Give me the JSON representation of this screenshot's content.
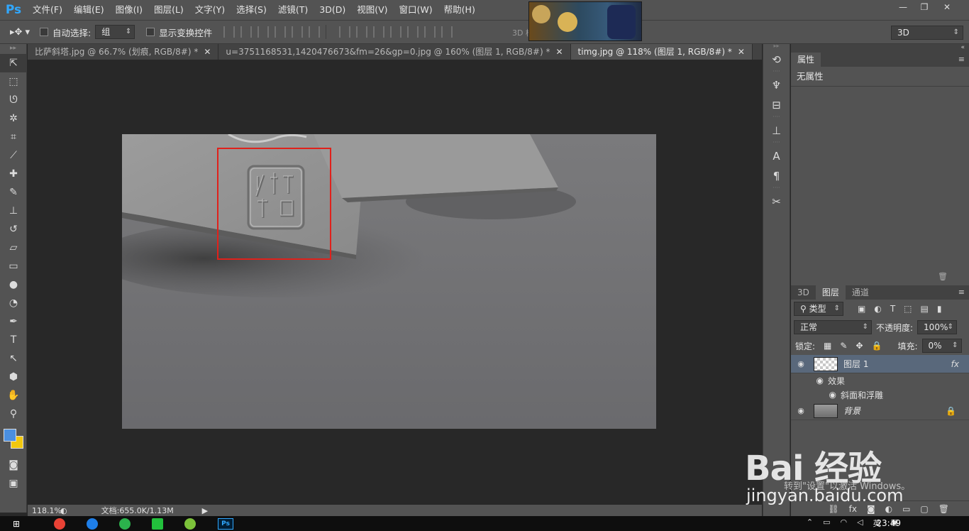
{
  "app": {
    "logo": "Ps"
  },
  "menu": [
    "文件(F)",
    "编辑(E)",
    "图像(I)",
    "图层(L)",
    "文字(Y)",
    "选择(S)",
    "滤镜(T)",
    "3D(D)",
    "视图(V)",
    "窗口(W)",
    "帮助(H)"
  ],
  "window_controls": [
    "—",
    "❐",
    "✕"
  ],
  "options_bar": {
    "auto_select_label": "自动选择:",
    "auto_select_value": "组",
    "show_transform_label": "显示变换控件",
    "mode_label": "3D 模式:",
    "workspace_value": "3D"
  },
  "tabs": [
    {
      "label": "比萨斜塔.jpg @ 66.7% (划痕, RGB/8#) *"
    },
    {
      "label": "u=3751168531,1420476673&fm=26&gp=0.jpg @ 160% (图层 1, RGB/8#) *"
    },
    {
      "label": "timg.jpg @ 118% (图层 1, RGB/8#) *"
    }
  ],
  "tab_close": "✕",
  "status": {
    "zoom": "118.1%",
    "doc_info": "文档:655.0K/1.13M"
  },
  "properties": {
    "tab_label": "属性",
    "empty_label": "无属性"
  },
  "layers_panel": {
    "tabs": [
      "3D",
      "图层",
      "通道"
    ],
    "active_tab": "图层",
    "filter_label": "类型",
    "blend_mode": "正常",
    "opacity_label": "不透明度:",
    "opacity_value": "100%",
    "lock_label": "锁定:",
    "fill_label": "填充:",
    "fill_value": "0%",
    "layers": [
      {
        "name": "图层 1",
        "fx": "fx"
      },
      {
        "name": "背景"
      }
    ],
    "effects_label": "效果",
    "effect_item": "斜面和浮雕"
  },
  "taskbar": {
    "clock": "23:49",
    "ime": "英"
  },
  "watermark": {
    "brand": "Bai 经验",
    "url": "jingyan.baidu.com",
    "activate_hint": "转到\"设置\"以激活 Windows。"
  },
  "colors": {
    "foreground": "#4a8fe0",
    "background": "#f2c80f",
    "selection_rect": "#e0211b"
  }
}
